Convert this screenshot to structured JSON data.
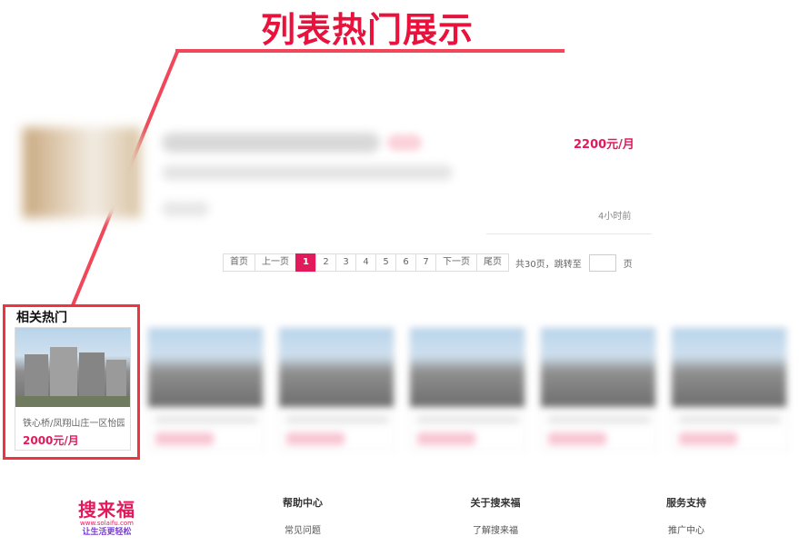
{
  "annotation": {
    "title": "列表热门展示"
  },
  "listing": {
    "price": "2200元/月",
    "time": "4小时前"
  },
  "pagination": {
    "first": "首页",
    "prev": "上一页",
    "pages": [
      "1",
      "2",
      "3",
      "4",
      "5",
      "6",
      "7"
    ],
    "current": "1",
    "next": "下一页",
    "last": "尾页",
    "total_text": "共30页，跳转至",
    "page_unit": "页"
  },
  "hot": {
    "heading": "相关热门",
    "featured": {
      "name": "铁心桥/凤翔山庄一区怡园",
      "price": "2000元/月"
    },
    "blurred_count": 5
  },
  "footer": {
    "logo": {
      "main": "搜来福",
      "url": "www.solaifu.com",
      "slogan": "让生活更轻松"
    },
    "columns": [
      {
        "title": "帮助中心",
        "links": [
          "常见问题"
        ]
      },
      {
        "title": "关于搜来福",
        "links": [
          "了解搜来福"
        ]
      },
      {
        "title": "服务支持",
        "links": [
          "推广中心"
        ]
      }
    ]
  },
  "colors": {
    "accent": "#e4195b",
    "annotation": "#e8123c"
  }
}
